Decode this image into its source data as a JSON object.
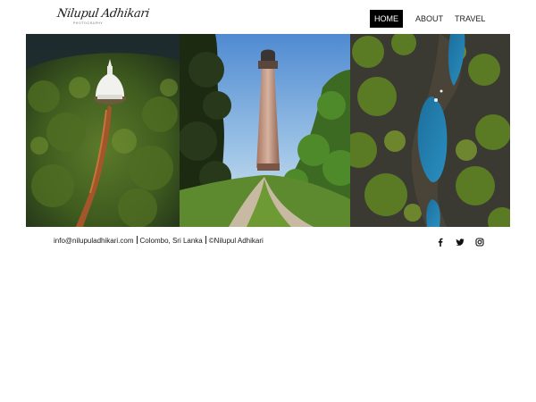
{
  "header": {
    "logo_text": "Nilupul Adhikari",
    "logo_subtext": "PHOTOGRAPHY"
  },
  "nav": {
    "items": [
      {
        "label": "HOME",
        "active": true
      },
      {
        "label": "ABOUT",
        "active": false
      },
      {
        "label": "TRAVEL",
        "active": false
      }
    ]
  },
  "footer": {
    "email": "info@nilupuladhikari.com",
    "location": "Colombo, Sri Lanka",
    "copyright": "©Nilupul Adhikari",
    "social_icons": [
      "facebook-icon",
      "twitter-icon",
      "instagram-icon"
    ]
  },
  "colors": {
    "nav_active_bg": "#000000",
    "nav_active_text": "#ffffff",
    "text": "#1a1a1a",
    "background": "#ffffff"
  }
}
